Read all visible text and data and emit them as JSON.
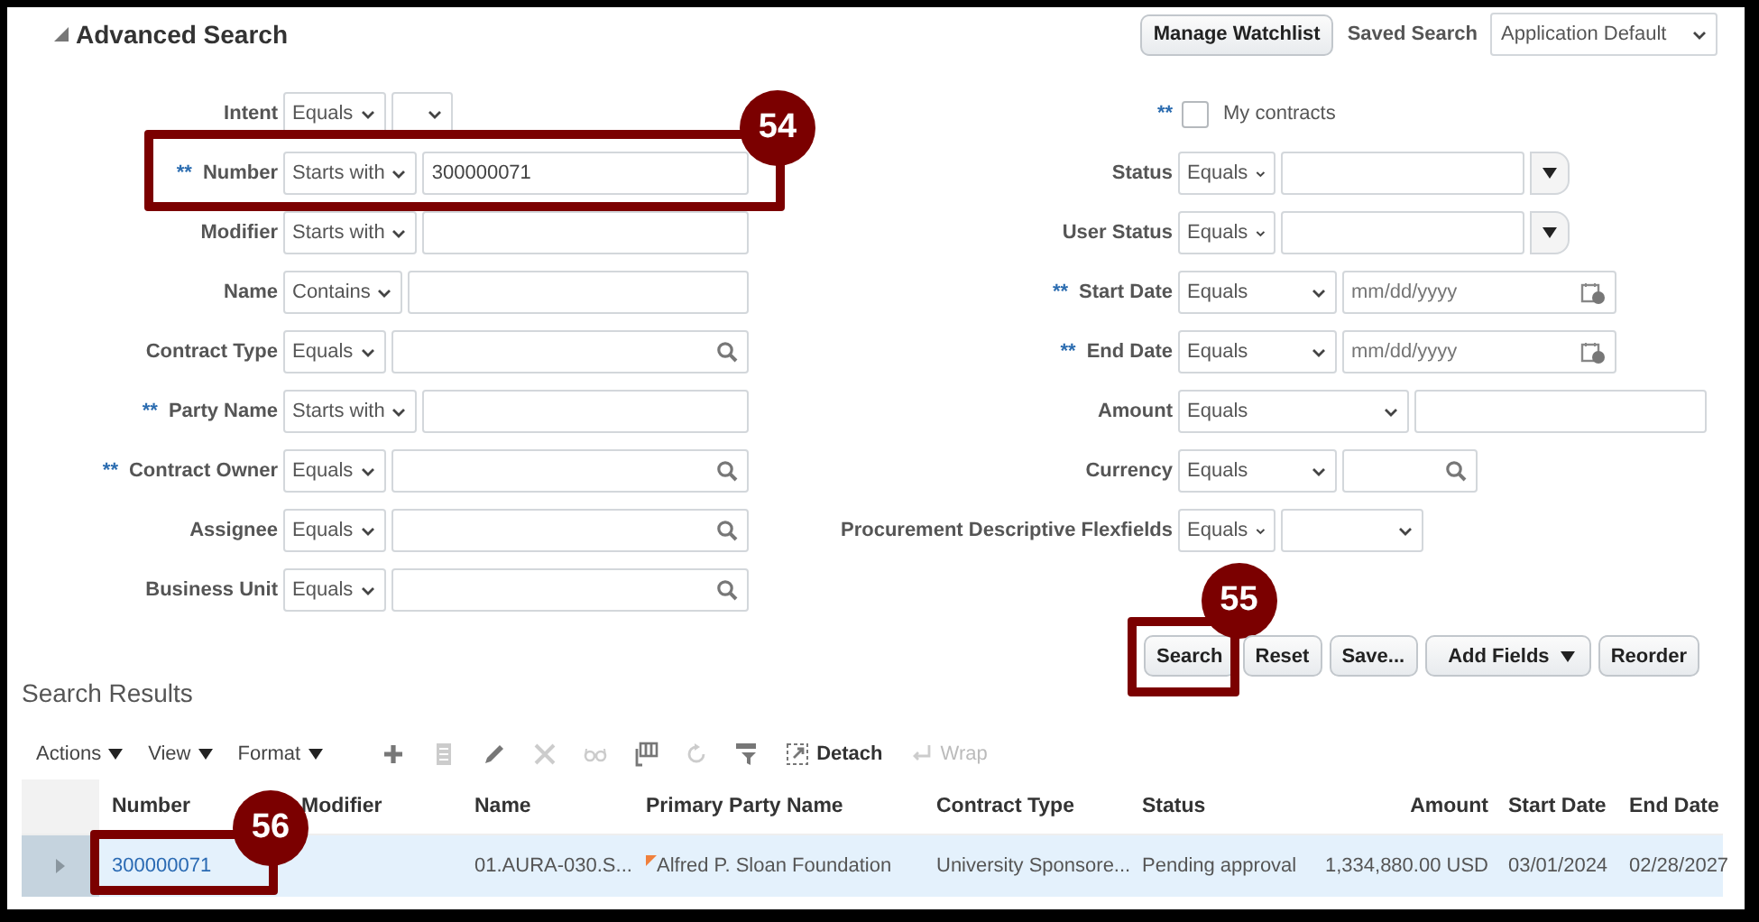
{
  "header": {
    "title": "Advanced Search",
    "expanded": true,
    "manage_button": "Manage Watchlist",
    "saved_search_label": "Saved Search",
    "saved_search_value": "Application Default"
  },
  "left_fields": [
    {
      "label": "Intent",
      "operator": "Equals",
      "kind": "select"
    },
    {
      "label": "Number",
      "mark": "**",
      "operator": "Starts with",
      "kind": "text",
      "value": "300000071",
      "callout": "54"
    },
    {
      "label": "Modifier",
      "operator": "Starts with",
      "kind": "text"
    },
    {
      "label": "Name",
      "operator": "Contains",
      "kind": "text"
    },
    {
      "label": "Contract Type",
      "operator": "Equals",
      "kind": "lookup"
    },
    {
      "label": "Party Name",
      "mark": "**",
      "operator": "Starts with",
      "kind": "text"
    },
    {
      "label": "Contract Owner",
      "mark": "**",
      "operator": "Equals",
      "kind": "lookup"
    },
    {
      "label": "Assignee",
      "operator": "Equals",
      "kind": "lookup"
    },
    {
      "label": "Business Unit",
      "operator": "Equals",
      "kind": "lookup"
    }
  ],
  "right_fields": [
    {
      "kind": "checkbox",
      "mark": "**",
      "text": "My contracts",
      "checked": false
    },
    {
      "label": "Status",
      "operator": "Equals",
      "kind": "combo"
    },
    {
      "label": "User Status",
      "operator": "Equals",
      "kind": "combo"
    },
    {
      "label": "Start Date",
      "mark": "**",
      "operator": "Equals",
      "kind": "date",
      "placeholder": "mm/dd/yyyy"
    },
    {
      "label": "End Date",
      "mark": "**",
      "operator": "Equals",
      "kind": "date",
      "placeholder": "mm/dd/yyyy"
    },
    {
      "label": "Amount",
      "operator": "Equals",
      "kind": "text"
    },
    {
      "label": "Currency",
      "operator": "Equals",
      "kind": "lookup"
    },
    {
      "label": "Procurement Descriptive Flexfields",
      "operator": "Equals",
      "kind": "select"
    }
  ],
  "buttons": [
    {
      "label": "Search",
      "kind": "plain",
      "callout": "55"
    },
    {
      "label": "Reset",
      "kind": "plain"
    },
    {
      "label": "Save...",
      "kind": "plain"
    },
    {
      "label": "Add Fields",
      "kind": "menu"
    },
    {
      "label": "Reorder",
      "kind": "plain"
    }
  ],
  "results": {
    "title": "Search Results",
    "menus": [
      "Actions",
      "View",
      "Format"
    ],
    "tools": [
      {
        "kind": "plus",
        "disabled": false
      },
      {
        "kind": "document",
        "disabled": true
      },
      {
        "kind": "pencil",
        "disabled": false
      },
      {
        "kind": "close",
        "disabled": true
      },
      {
        "kind": "glasses",
        "disabled": true
      },
      {
        "kind": "freeze",
        "disabled": false
      },
      {
        "kind": "refresh",
        "disabled": true
      },
      {
        "kind": "filter",
        "disabled": false
      },
      {
        "kind": "detach",
        "label": "Detach",
        "disabled": false
      },
      {
        "kind": "wrap",
        "label": "Wrap",
        "disabled": true
      }
    ],
    "columns": [
      "Number",
      "Modifier",
      "Name",
      "Primary Party Name",
      "Contract Type",
      "Status",
      "Amount",
      "Start Date",
      "End Date"
    ],
    "rows": [
      {
        "selected": true,
        "cells": [
          {
            "text": "300000071",
            "kind": "link",
            "callout": "56"
          },
          {
            "text": ""
          },
          {
            "text": "01.AURA-030.S..."
          },
          {
            "text": "Alfred P. Sloan Foundation",
            "kind": "flagged"
          },
          {
            "text": "University Sponsore..."
          },
          {
            "text": "Pending approval"
          },
          {
            "text": "1,334,880.00 USD",
            "kind": "amount"
          },
          {
            "text": "03/01/2024"
          },
          {
            "text": "02/28/2027"
          }
        ]
      }
    ]
  }
}
